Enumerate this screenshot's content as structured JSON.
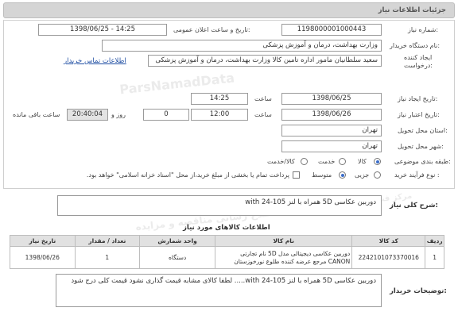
{
  "header": {
    "title": "جزئیات اطلاعات نیاز"
  },
  "form": {
    "need_number_label": "شماره نیاز:",
    "need_number": "1198000001000443",
    "announce_label": "تاریخ و ساعت اعلان عمومی:",
    "announce_value": "1398/06/25 - 14:25",
    "buyer_label": "نام دستگاه خریدار:",
    "buyer_value": "وزارت بهداشت، درمان و آموزش پزشکی",
    "creator_label_1": "ایجاد کننده",
    "creator_label_2": "درخواست:",
    "creator_value": "سعید سلطانیان مامور اداره تامین کالا وزارت بهداشت، درمان و آموزش پزشکی",
    "contact_link": "اطلاعات تماس خریدار",
    "created_label": "تاریخ ایجاد نیاز:",
    "created_date": "1398/06/25",
    "created_time_label": "ساعت",
    "created_time": "14:25",
    "valid_label": "تاریخ اعتبار نیاز:",
    "valid_date": "1398/06/26",
    "valid_time_label": "ساعت",
    "valid_time": "12:00",
    "days_value": "0",
    "days_label": "روز و",
    "remaining_time": "20:40:04",
    "remaining_label": "ساعت باقی مانده",
    "province_label": "استان محل تحویل:",
    "province_value": "تهران",
    "city_label": "شهر محل تحویل:",
    "city_value": "تهران",
    "category_label": "طبقه بندی موضوعی:",
    "category_options": [
      "کالا",
      "خدمت",
      "کالا/خدمت"
    ],
    "purchase_label": "نوع فرآیند خرید :",
    "purchase_options": [
      "جزیی",
      "متوسط"
    ],
    "payment_note": "پرداخت تمام یا بخشی از مبلغ خرید،از محل \"اسناد خزانه اسلامی\" خواهد بود."
  },
  "summary": {
    "label": "شرح کلی نیاز:",
    "value": "دوربین عکاسی 5D همراه با لنز 105-24 with"
  },
  "items_section": {
    "title": "اطلاعات کالاهای مورد نیاز"
  },
  "items_table": {
    "headers": [
      "ردیف",
      "کد کالا",
      "نام کالا",
      "واحد شمارش",
      "تعداد / مقدار",
      "تاریخ نیاز"
    ],
    "rows": [
      {
        "row": "1",
        "code": "2242101073370016",
        "name": "دوربین عکاسی دیجیتالی مدل 5D نام تجارتی CANON مرجع عرضه کننده طلوع نورخوزستان",
        "unit": "دستگاه",
        "qty": "1",
        "date": "1398/06/26"
      }
    ]
  },
  "buyer_notes": {
    "label": "توضیحات خریدار:",
    "value": "دوربین عکاسی 5D همراه با لنز 105-24 with..... لطفا کالای مشابه قیمت گذاری نشود قیمت کلی درج شود"
  },
  "watermark": {
    "line1": "پایگاه اطلاع رسانی مناقصه و مزایده",
    "line2": "مرکز فناوری اطلاعات پارس نماد داده ها",
    "line3": "ParsNamadData"
  }
}
